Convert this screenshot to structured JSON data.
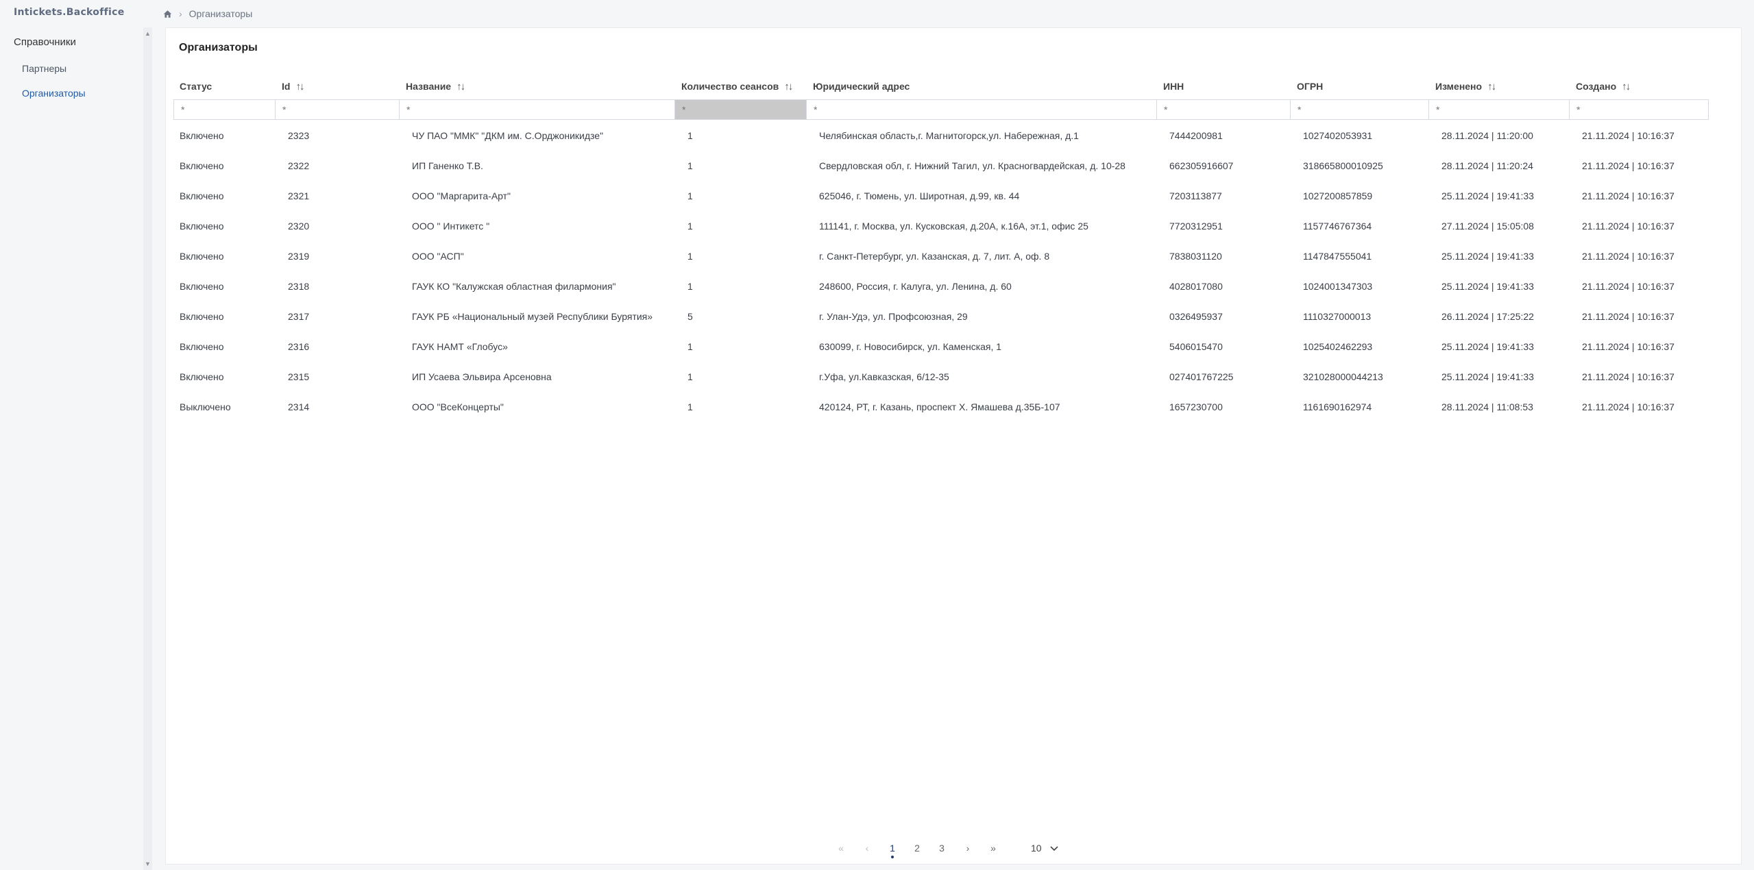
{
  "app": {
    "logo": "Intickets.Backoffice"
  },
  "breadcrumb": {
    "current": "Организаторы"
  },
  "sidebar": {
    "section_title": "Справочники",
    "items": [
      {
        "label": "Партнеры",
        "active": false
      },
      {
        "label": "Организаторы",
        "active": true
      }
    ]
  },
  "page": {
    "title": "Организаторы"
  },
  "table": {
    "columns": [
      {
        "label": "Статус",
        "sortable": false
      },
      {
        "label": "Id",
        "sortable": true
      },
      {
        "label": "Название",
        "sortable": true
      },
      {
        "label": "Количество сеансов",
        "sortable": true
      },
      {
        "label": "Юридический адрес",
        "sortable": false
      },
      {
        "label": "ИНН",
        "sortable": false
      },
      {
        "label": "ОГРН",
        "sortable": false
      },
      {
        "label": "Изменено",
        "sortable": true
      },
      {
        "label": "Создано",
        "sortable": true
      }
    ],
    "filter_placeholder": "*",
    "rows": [
      [
        "Включено",
        "2323",
        "ЧУ ПАО \"ММК\" \"ДКМ им. С.Орджоникидзе\"",
        "1",
        "Челябинская область,г. Магнитогорск,ул. Набережная, д.1",
        "7444200981",
        "1027402053931",
        "28.11.2024 | 11:20:00",
        "21.11.2024 | 10:16:37"
      ],
      [
        "Включено",
        "2322",
        "ИП Ганенко Т.В.",
        "1",
        "Свердловская обл, г. Нижний Тагил, ул. Красногвардейская, д. 10-28",
        "662305916607",
        "318665800010925",
        "28.11.2024 | 11:20:24",
        "21.11.2024 | 10:16:37"
      ],
      [
        "Включено",
        "2321",
        "ООО \"Маргарита-Арт\"",
        "1",
        "625046, г. Тюмень, ул. Широтная, д.99, кв. 44",
        "7203113877",
        "1027200857859",
        "25.11.2024 | 19:41:33",
        "21.11.2024 | 10:16:37"
      ],
      [
        "Включено",
        "2320",
        "ООО \" Интикетс \"",
        "1",
        "111141, г. Москва, ул. Кусковская, д.20А, к.16А, эт.1, офис 25",
        "7720312951",
        "1157746767364",
        "27.11.2024 | 15:05:08",
        "21.11.2024 | 10:16:37"
      ],
      [
        "Включено",
        "2319",
        "ООО \"АСП\"",
        "1",
        "г. Санкт-Петербург, ул. Казанская, д. 7, лит. А, оф. 8",
        "7838031120",
        "1147847555041",
        "25.11.2024 | 19:41:33",
        "21.11.2024 | 10:16:37"
      ],
      [
        "Включено",
        "2318",
        "ГАУК КО \"Калужская областная филармония\"",
        "1",
        "248600, Россия, г. Калуга, ул. Ленина, д. 60",
        "4028017080",
        "1024001347303",
        "25.11.2024 | 19:41:33",
        "21.11.2024 | 10:16:37"
      ],
      [
        "Включено",
        "2317",
        "ГАУК РБ «Национальный музей Республики Бурятия»",
        "5",
        "г. Улан-Удэ, ул. Профсоюзная, 29",
        "0326495937",
        "1110327000013",
        "26.11.2024 | 17:25:22",
        "21.11.2024 | 10:16:37"
      ],
      [
        "Включено",
        "2316",
        "ГАУК НАМТ «Глобус»",
        "1",
        "630099, г. Новосибирск, ул. Каменская, 1",
        "5406015470",
        "1025402462293",
        "25.11.2024 | 19:41:33",
        "21.11.2024 | 10:16:37"
      ],
      [
        "Включено",
        "2315",
        "ИП Усаева Эльвира Арсеновна",
        "1",
        "г.Уфа, ул.Кавказская, 6/12-35",
        "027401767225",
        "321028000044213",
        "25.11.2024 | 19:41:33",
        "21.11.2024 | 10:16:37"
      ],
      [
        "Выключено",
        "2314",
        "ООО \"ВсеКонцерты\"",
        "1",
        "420124, РТ, г. Казань, проспект Х. Ямашева д.35Б-107",
        "1657230700",
        "1161690162974",
        "28.11.2024 | 11:08:53",
        "21.11.2024 | 10:16:37"
      ]
    ]
  },
  "pagination": {
    "pages": [
      "1",
      "2",
      "3"
    ],
    "current": "1",
    "page_size": "10",
    "first_icon": "double-chevron-left-icon",
    "prev_icon": "chevron-left-icon",
    "next_icon": "chevron-right-icon",
    "last_icon": "double-chevron-right-icon"
  },
  "colors": {
    "accent": "#1e5aa8",
    "active_filter_bg": "#c9c9c9"
  }
}
